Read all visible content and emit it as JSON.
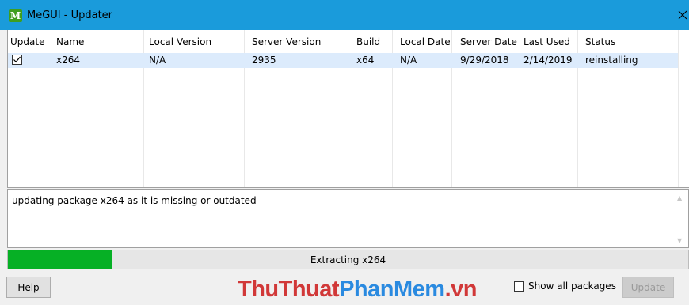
{
  "window": {
    "title": "MeGUI - Updater",
    "icon_glyph": "M",
    "icon": "megui-app-icon",
    "close_icon": "close-icon"
  },
  "table": {
    "columns": [
      "Update",
      "Name",
      "Local Version",
      "Server Version",
      "Build",
      "Local Date",
      "Server Date",
      "Last Used",
      "Status"
    ],
    "rows": [
      {
        "update_checked": true,
        "name": "x264",
        "local_version": "N/A",
        "server_version": "2935",
        "build": "x64",
        "local_date": "N/A",
        "server_date": "9/29/2018",
        "last_used": "2/14/2019",
        "status": "reinstalling"
      }
    ]
  },
  "log": {
    "text": "updating package x264 as it is missing or outdated"
  },
  "progress": {
    "label": "Extracting x264",
    "fraction": 0.153,
    "color": "#06b025"
  },
  "footer": {
    "help_label": "Help",
    "show_all_label": "Show all packages",
    "show_all_checked": false,
    "update_label": "Update",
    "update_enabled": false
  },
  "watermark": {
    "part1": "ThuThuat",
    "part2": "PhanMem",
    "part3": ".vn"
  },
  "colors": {
    "titlebar": "#1a9bdb",
    "selected_row": "#dcebfc",
    "watermark_red": "#d13838",
    "watermark_blue": "#2a8ae0"
  }
}
